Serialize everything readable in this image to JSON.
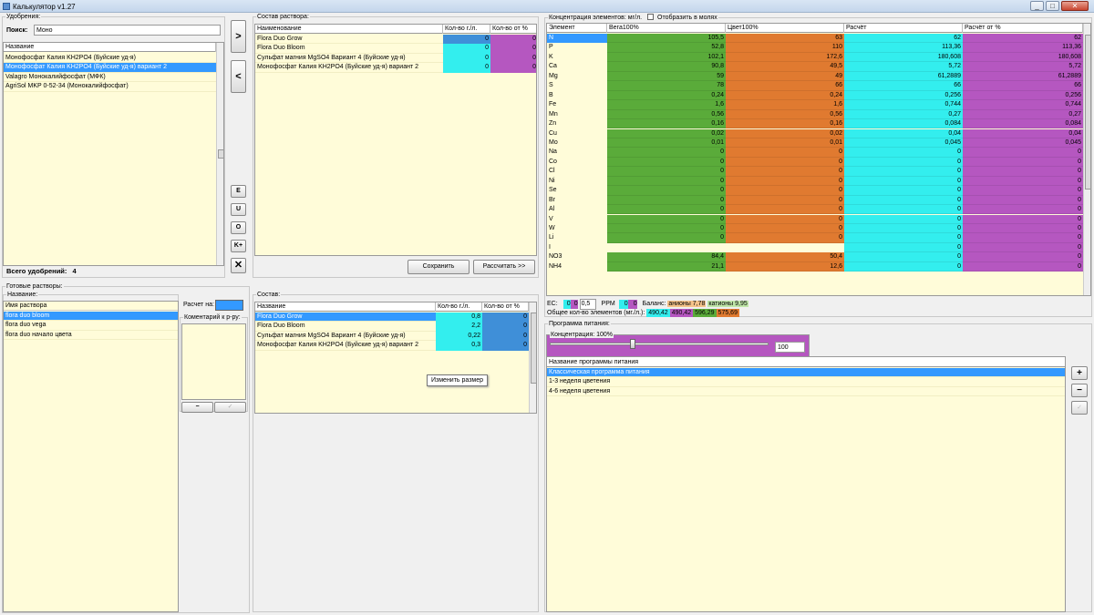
{
  "window": {
    "title": "Калькулятор v1.27",
    "min": "_",
    "max": "□",
    "close": "✕"
  },
  "fertilizers": {
    "legend": "Удобрения:",
    "search_label": "Поиск:",
    "search_value": "Моно",
    "col_name": "Название",
    "items": [
      "Монофосфат Калия KH2PO4 (Буйские уд-я)",
      "Монофосфат Калия KH2PO4 (Буйские уд-я) вариант 2",
      "Valagro Монокалийфосфат (МФК)",
      "AgriSol MKP 0-52-34 (Монокалийфосфат)"
    ],
    "total_label": "Всего удобрений:",
    "total_value": "4"
  },
  "side_buttons": {
    "add": ">",
    "remove": "<",
    "e": "E",
    "u": "U",
    "o": "O",
    "kplus": "K+",
    "clear": "✕"
  },
  "composition": {
    "legend": "Состав раствора:",
    "cols": [
      "Наименование",
      "Кол-во г./л.",
      "Кол-во от %"
    ],
    "rows": [
      {
        "name": "Flora Duo Grow",
        "g": "0",
        "p": "0"
      },
      {
        "name": "Flora Duo Bloom",
        "g": "0",
        "p": "0"
      },
      {
        "name": "Сульфат магния MgSO4 Вариант 4 (Буйские уд-я)",
        "g": "0",
        "p": "0"
      },
      {
        "name": "Монофосфат Калия KH2PO4 (Буйские уд-я) вариант 2",
        "g": "0",
        "p": "0"
      }
    ],
    "save": "Сохранить",
    "calc": "Рассчитать >>"
  },
  "concentration": {
    "legend": "Концентрация элементов: мг/л.",
    "moles_label": "Отобразить в молях",
    "cols": [
      "Элемент",
      "Вега100%",
      "Цвет100%",
      "Расчёт",
      "Расчёт от %"
    ],
    "rows": [
      [
        "N",
        "105,5",
        "63",
        "62",
        "62"
      ],
      [
        "P",
        "52,8",
        "110",
        "113,36",
        "113,36"
      ],
      [
        "K",
        "102,1",
        "172,6",
        "180,608",
        "180,608"
      ],
      [
        "Ca",
        "90,8",
        "49,5",
        "5,72",
        "5,72"
      ],
      [
        "Mg",
        "59",
        "49",
        "61,2889",
        "61,2889"
      ],
      [
        "S",
        "78",
        "66",
        "66",
        "66"
      ],
      [
        "B",
        "0,24",
        "0,24",
        "0,256",
        "0,256"
      ],
      [
        "Fe",
        "1,6",
        "1,6",
        "0,744",
        "0,744"
      ],
      [
        "Mn",
        "0,56",
        "0,56",
        "0,27",
        "0,27"
      ],
      [
        "Zn",
        "0,16",
        "0,16",
        "0,084",
        "0,084"
      ],
      [
        "Cu",
        "0,02",
        "0,02",
        "0,04",
        "0,04"
      ],
      [
        "Mo",
        "0,01",
        "0,01",
        "0,045",
        "0,045"
      ],
      [
        "Na",
        "0",
        "0",
        "0",
        "0"
      ],
      [
        "Co",
        "0",
        "0",
        "0",
        "0"
      ],
      [
        "Cl",
        "0",
        "0",
        "0",
        "0"
      ],
      [
        "Ni",
        "0",
        "0",
        "0",
        "0"
      ],
      [
        "Se",
        "0",
        "0",
        "0",
        "0"
      ],
      [
        "Br",
        "0",
        "0",
        "0",
        "0"
      ],
      [
        "Al",
        "0",
        "0",
        "0",
        "0"
      ],
      [
        "V",
        "0",
        "0",
        "0",
        "0"
      ],
      [
        "W",
        "0",
        "0",
        "0",
        "0"
      ],
      [
        "Li",
        "0",
        "0",
        "0",
        "0"
      ],
      [
        "I",
        "",
        "",
        "0",
        "0"
      ],
      [
        "NO3",
        "84,4",
        "50,4",
        "0",
        "0"
      ],
      [
        "NH4",
        "21,1",
        "12,6",
        "0",
        "0"
      ]
    ],
    "ec_label": "EC:",
    "ec_vals": [
      "0",
      "0",
      "0,5"
    ],
    "ppm_label": "PPM",
    "ppm_vals": [
      "0",
      "0"
    ],
    "balance_label": "Баланс:",
    "anions": "анионы 7,78",
    "cations": "катионы 9,95",
    "total_label": "Общее кол-во элементов (мг./л.):",
    "totals": [
      "490,42",
      "490,42",
      "596,29",
      "575,69"
    ]
  },
  "ready": {
    "legend": "Готовые растворы:",
    "name_label": "Название:",
    "col": "Имя раствора",
    "items": [
      "flora duo bloom",
      "flora duo vega",
      "flora duo начало цвета"
    ],
    "calc_label": "Расчет на:",
    "comment_label": "Коментарий к р-ру:",
    "minus": "−",
    "check": "✓"
  },
  "sostav": {
    "legend": "Состав:",
    "cols": [
      "Название",
      "Кол-во г./л.",
      "Кол-во от %"
    ],
    "rows": [
      {
        "name": "Flora Duo Grow",
        "g": "0,8",
        "p": "0"
      },
      {
        "name": "Flora Duo Bloom",
        "g": "2,2",
        "p": "0"
      },
      {
        "name": "Сульфат магния MgSO4 Вариант 4 (Буйские уд-я)",
        "g": "0,22",
        "p": "0"
      },
      {
        "name": "Монофосфат Калия KH2PO4 (Буйские уд-я) вариант 2",
        "g": "0,3",
        "p": "0"
      }
    ],
    "tooltip": "Изменить размер"
  },
  "program": {
    "legend": "Программа питания:",
    "conc_legend": "Концентрация: 100%",
    "conc_value": "100",
    "slider_level": 0.38,
    "col": "Название программы питания",
    "items": [
      "Классическая программа питания",
      "1-3 неделя цветения",
      "4-6 неделя цветения"
    ],
    "plus": "+",
    "minus": "−",
    "check": "✓"
  },
  "colors": {
    "green": "#5aab3a",
    "orange": "#e07a30",
    "cyan": "#33eeee",
    "purple": "#b557c0",
    "selection": "#3399ff",
    "list_bg": "#fffcd9"
  }
}
